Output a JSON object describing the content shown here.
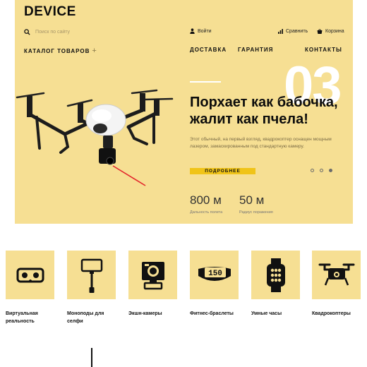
{
  "header": {
    "logo": "DEVICE",
    "search_placeholder": "Поиск по сайту",
    "login": "Войти",
    "compare": "Сравнить",
    "cart": "Корзина"
  },
  "nav": {
    "catalog": "КАТАЛОГ ТОВАРОВ",
    "delivery": "ДОСТАВКА",
    "warranty": "ГАРАНТИЯ",
    "contacts": "КОНТАКТЫ"
  },
  "hero": {
    "slide_number": "03",
    "title": "Порхает как бабочка, жалит как пчела!",
    "description": "Этот обычный, на первый взгляд, квадрокоптер оснащен мощным лазером, замаскированным под стандартную камеру.",
    "button": "ПОДРОБНЕЕ",
    "slides": 3,
    "active_slide": 3,
    "stats": [
      {
        "value": "800 м",
        "label": "Дальность полета"
      },
      {
        "value": "50 м",
        "label": "Радиус поражения"
      }
    ]
  },
  "categories": [
    {
      "label": "Виртуальная реальность",
      "icon": "vr-headset-icon"
    },
    {
      "label": "Моноподы для селфи",
      "icon": "selfie-stick-icon"
    },
    {
      "label": "Экшн-камеры",
      "icon": "action-camera-icon"
    },
    {
      "label": "Фитнес-браслеты",
      "icon": "fitness-band-icon"
    },
    {
      "label": "Умные часы",
      "icon": "smartwatch-icon"
    },
    {
      "label": "Квадрокоптеры",
      "icon": "quadcopter-icon"
    }
  ],
  "fitness_band_display": "150",
  "colors": {
    "hero_bg": "#f6df93",
    "accent": "#f0c419",
    "laser": "#e3242b"
  }
}
